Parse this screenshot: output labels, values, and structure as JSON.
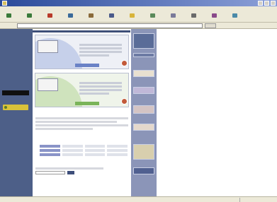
{
  "window": {
    "title": "",
    "colors": {
      "titlebar": "#2a4a9a",
      "chrome": "#ece9d8"
    }
  },
  "menu": {
    "items": [
      "",
      "",
      "",
      "",
      "",
      ""
    ]
  },
  "toolbar": {
    "buttons": [
      {
        "label": "",
        "icon": "back-icon",
        "color": "#3a7a3a"
      },
      {
        "label": "",
        "icon": "forward-icon",
        "color": "#3a7a3a"
      },
      {
        "label": "",
        "icon": "stop-icon",
        "color": "#b83a2a"
      },
      {
        "label": "",
        "icon": "refresh-icon",
        "color": "#3a6a9a"
      },
      {
        "label": "",
        "icon": "home-icon",
        "color": "#8a6a3a"
      },
      {
        "label": "",
        "icon": "search-icon",
        "color": "#4a5a8a"
      },
      {
        "label": "",
        "icon": "favorites-icon",
        "color": "#d8b43a"
      },
      {
        "label": "",
        "icon": "history-icon",
        "color": "#5a8a5a"
      },
      {
        "label": "",
        "icon": "mail-icon",
        "color": "#7a7a9a"
      },
      {
        "label": "",
        "icon": "print-icon",
        "color": "#6a6a6a"
      },
      {
        "label": "",
        "icon": "edit-icon",
        "color": "#8a4a8a"
      },
      {
        "label": "",
        "icon": "discuss-icon",
        "color": "#4a8aa8"
      }
    ]
  },
  "address": {
    "label": "",
    "url": "",
    "go_label": "",
    "links_label": ""
  },
  "site": {
    "logo_text": "",
    "nav_items": [
      "",
      "",
      "",
      "",
      "",
      "",
      "",
      "",
      ""
    ],
    "black_box_label": "",
    "badge_label": "",
    "colors": {
      "nav_bg": "#4d5f88",
      "right_bg": "#8b95b8",
      "accent": "#3e4f78"
    }
  },
  "banners": [
    {
      "box_title": "",
      "box_sub": "",
      "heading": "",
      "button": "",
      "accent": "#6a82c6"
    },
    {
      "box_title": "",
      "box_sub": "",
      "heading": "",
      "button": "",
      "accent": "#7ab45a"
    }
  ],
  "articles": {
    "heading": "",
    "link": ""
  },
  "bottom": {
    "heading": "",
    "search_label": ""
  },
  "right_ads": [
    "",
    "",
    "",
    "",
    "",
    "",
    "",
    ""
  ],
  "status": {
    "text": "",
    "zone": ""
  }
}
